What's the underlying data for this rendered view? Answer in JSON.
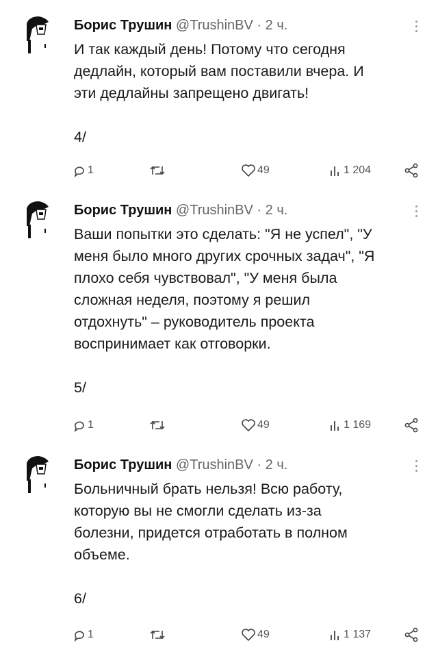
{
  "tweets": [
    {
      "author": "Борис Трушин",
      "handle": "@TrushinBV",
      "time": "· 2 ч.",
      "text_lines": [
        "И так каждый день! Потому что сегодня",
        "дедлайн, который вам поставили вчера. И",
        "эти дедлайны запрещено двигать!"
      ],
      "number": "4/",
      "replies": "1",
      "likes": "49",
      "views": "1 204"
    },
    {
      "author": "Борис Трушин",
      "handle": "@TrushinBV",
      "time": "· 2 ч.",
      "text_lines": [
        "Ваши попытки это сделать: \"Я не успел\", \"У",
        "меня было много других срочных задач\", \"Я",
        "плохо себя чувствовал\", \"У меня была",
        "сложная неделя, поэтому я решил",
        "отдохнуть\" – руководитель проекта",
        "воспринимает как отговорки."
      ],
      "number": "5/",
      "replies": "1",
      "likes": "49",
      "views": "1 169"
    },
    {
      "author": "Борис Трушин",
      "handle": "@TrushinBV",
      "time": "· 2 ч.",
      "text_lines": [
        "Больничный брать нельзя! Всю работу,",
        "которую вы не смогли сделать из-за",
        "болезни, придется отработать в полном",
        "объеме."
      ],
      "number": "6/",
      "replies": "1",
      "likes": "49",
      "views": "1 137"
    }
  ],
  "icons": {
    "avatar": "silhouette-avatar",
    "more": "more-options-icon",
    "reply": "reply-icon",
    "retweet": "retweet-icon",
    "like": "like-icon",
    "views": "views-icon",
    "share": "share-icon"
  }
}
